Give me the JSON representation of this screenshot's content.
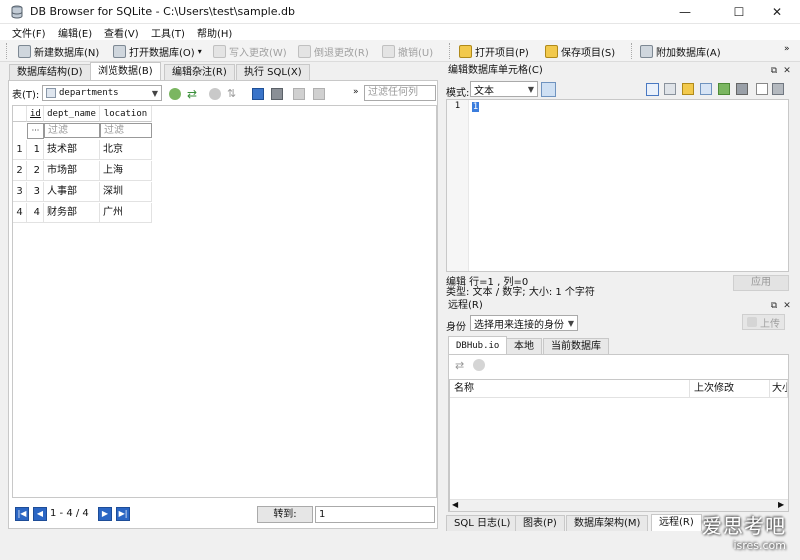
{
  "window": {
    "title": "DB Browser for SQLite - C:\\Users\\test\\sample.db",
    "minimize": "—",
    "maximize": "☐",
    "close": "✕"
  },
  "menu": [
    "文件(F)",
    "编辑(E)",
    "查看(V)",
    "工具(T)",
    "帮助(H)"
  ],
  "toolbar": {
    "new_db": "新建数据库(N)",
    "open_db": "打开数据库(O)",
    "write_changes": "写入更改(W)",
    "revert_changes": "倒退更改(R)",
    "undo": "撤销(U)",
    "open_project": "打开项目(P)",
    "save_project": "保存项目(S)",
    "attach_db": "附加数据库(A)"
  },
  "main_tabs": [
    "数据库结构(D)",
    "浏览数据(B)",
    "编辑杂注(R)",
    "执行 SQL(X)"
  ],
  "browse": {
    "table_label": "表(T):",
    "table_name": "departments",
    "global_filter_placeholder": "过滤任何列",
    "columns": [
      "id",
      "dept_name",
      "location"
    ],
    "filter_placeholder": "过滤",
    "filter_row_marker": "···",
    "rows": [
      {
        "rownum": "1",
        "id": "1",
        "dept_name": "技术部",
        "location": "北京"
      },
      {
        "rownum": "2",
        "id": "2",
        "dept_name": "市场部",
        "location": "上海"
      },
      {
        "rownum": "3",
        "id": "3",
        "dept_name": "人事部",
        "location": "深圳"
      },
      {
        "rownum": "4",
        "id": "4",
        "dept_name": "财务部",
        "location": "广州"
      }
    ],
    "record_count": "1 - 4 / 4",
    "goto_label": "转到:",
    "goto_value": "1"
  },
  "edit_cell": {
    "title": "编辑数据库单元格(C)",
    "mode_label": "模式:",
    "mode_value": "文本",
    "line_number": "1",
    "content": "1",
    "position": "编辑 行=1 , 列=0",
    "type_info": "类型: 文本 / 数字; 大小: 1 个字符",
    "apply": "应用"
  },
  "remote": {
    "title": "远程(R)",
    "identity_label": "身份",
    "identity_value": "选择用来连接的身份",
    "upload": "上传",
    "tabs": [
      "DBHub.io",
      "本地",
      "当前数据库"
    ],
    "columns": [
      "名称",
      "上次修改",
      "大小"
    ]
  },
  "bottom_tabs": [
    "SQL 日志(L)",
    "图表(P)",
    "数据库架构(M)",
    "远程(R)"
  ],
  "watermark": {
    "line1": "爱思考吧",
    "line2": "isres.com"
  },
  "colors": {
    "accent": "#2b66c4",
    "selection": "#3b7ddd"
  }
}
